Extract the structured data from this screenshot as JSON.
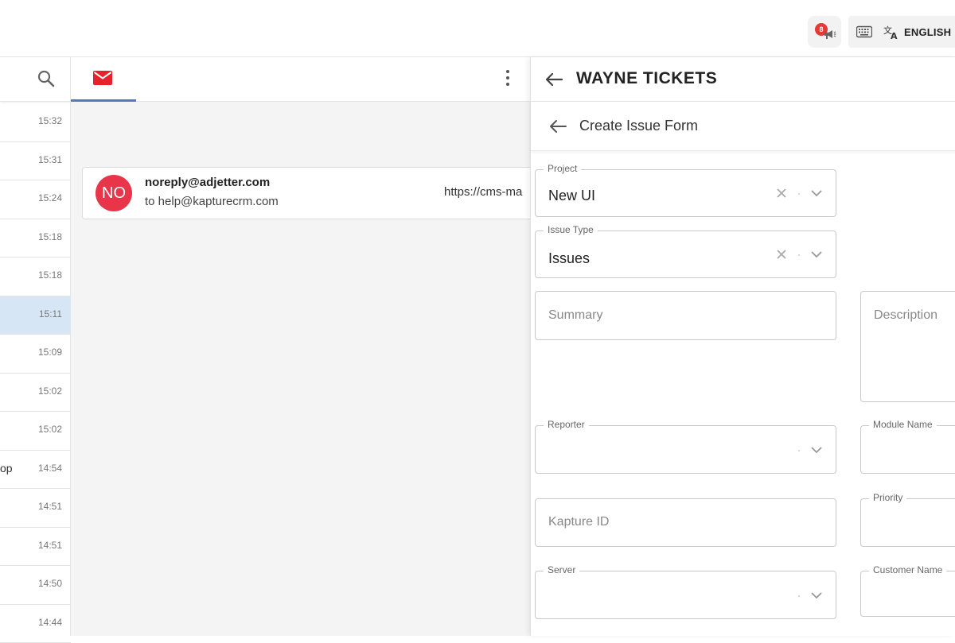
{
  "header": {
    "notification_count": "8",
    "language": "ENGLISH"
  },
  "list": {
    "times": [
      "15:32",
      "15:31",
      "15:24",
      "15:18",
      "15:18",
      "15:11",
      "15:09",
      "15:02",
      "15:02",
      "14:54",
      "14:51",
      "14:51",
      "14:50",
      "14:44"
    ],
    "row_10_text": "op"
  },
  "mail": {
    "avatar_initials": "NO",
    "from": "noreply@adjetter.com",
    "to": "to help@kapturecrm.com",
    "snippet": "https://cms-ma"
  },
  "ticket": {
    "title": "WAYNE TICKETS",
    "form_title": "Create Issue Form",
    "project_label": "Project",
    "project_value": "New UI",
    "issue_type_label": "Issue Type",
    "issue_type_value": "Issues",
    "summary_placeholder": "Summary",
    "description_placeholder": "Description",
    "reporter_label": "Reporter",
    "module_name_label": "Module Name",
    "kapture_id_placeholder": "Kapture ID",
    "priority_label": "Priority",
    "server_label": "Server",
    "customer_name_label": "Customer Name"
  },
  "colors": {
    "accent_red": "#e53935",
    "avatar_red": "#e8354a",
    "tab_underline": "#5b74c4",
    "selected_row": "#d6e6f5"
  },
  "icons": [
    "megaphone-icon",
    "keyboard-icon",
    "translate-icon",
    "search-icon",
    "mail-icon",
    "more-vert-icon",
    "arrow-back-icon",
    "clear-icon",
    "chevron-down-icon"
  ]
}
